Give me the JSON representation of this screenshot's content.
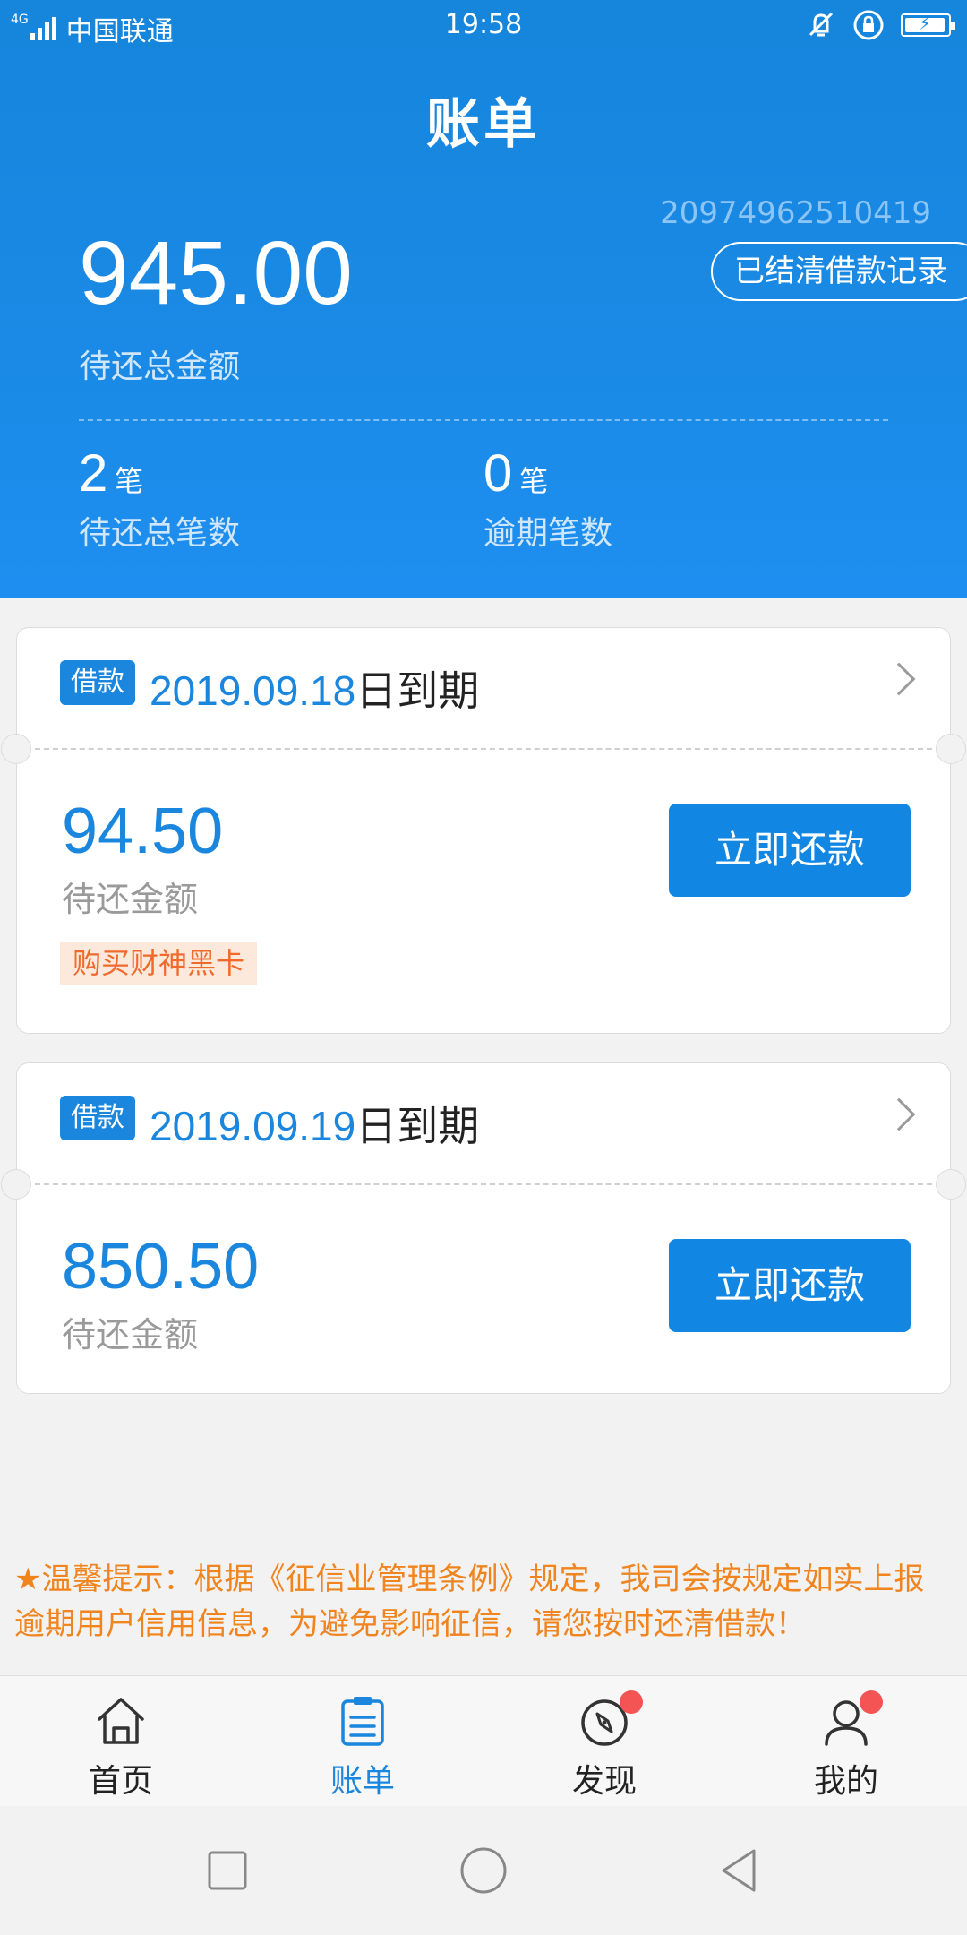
{
  "statusbar": {
    "signal_tag": "4G",
    "carrier": "中国联通",
    "time": "19:58"
  },
  "header": {
    "title": "账单",
    "account_id": "20974962510419",
    "settled_button": "已结清借款记录",
    "total_amount": "945.00",
    "total_label": "待还总金额",
    "stats": [
      {
        "num": "2",
        "unit": "笔",
        "label": "待还总笔数"
      },
      {
        "num": "0",
        "unit": "笔",
        "label": "逾期笔数"
      }
    ]
  },
  "loans": [
    {
      "tag": "借款",
      "date": "2019.09.18",
      "date_suffix": "日到期",
      "amount": "94.50",
      "amount_label": "待还金额",
      "promo": "购买财神黑卡",
      "pay_button": "立即还款"
    },
    {
      "tag": "借款",
      "date": "2019.09.19",
      "date_suffix": "日到期",
      "amount": "850.50",
      "amount_label": "待还金额",
      "pay_button": "立即还款"
    }
  ],
  "notice": "★温馨提示：根据《征信业管理条例》规定，我司会按规定如实上报逾期用户信用信息，为避免影响征信，请您按时还清借款！",
  "tabbar": [
    {
      "label": "首页",
      "icon": "home-icon"
    },
    {
      "label": "账单",
      "icon": "bill-icon",
      "active": true
    },
    {
      "label": "发现",
      "icon": "compass-icon",
      "badge": true
    },
    {
      "label": "我的",
      "icon": "user-icon",
      "badge": true
    }
  ],
  "colors": {
    "primary": "#1a86dd",
    "promo_text": "#f06a2c",
    "notice_text": "#f0841e",
    "badge": "#f55454"
  }
}
